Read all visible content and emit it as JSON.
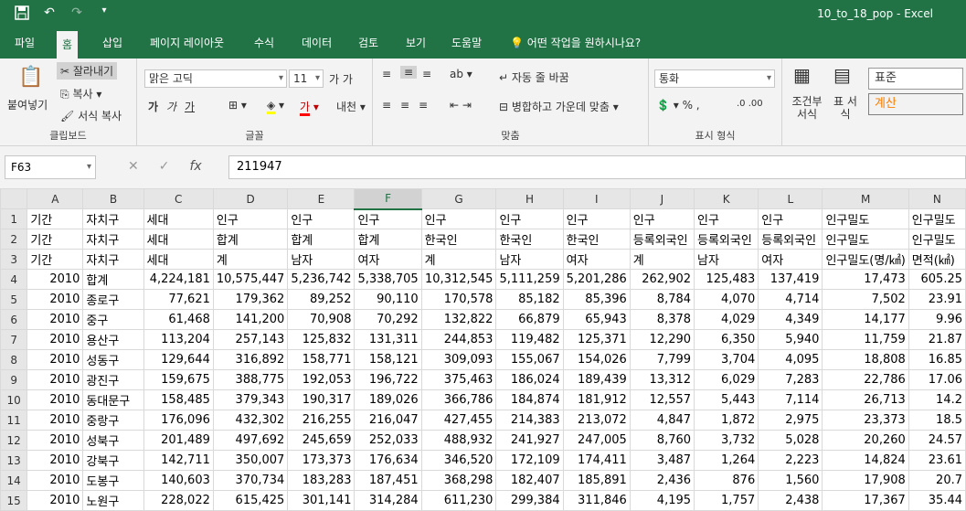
{
  "title_bar": {
    "window_title": "10_to_18_pop  -  Excel",
    "qat": {
      "save_icon": "save-icon",
      "undo_icon": "undo-icon",
      "redo_icon": "redo-icon",
      "customize_icon": "chevron-down-icon"
    }
  },
  "menu": {
    "tabs": [
      "파일",
      "홈",
      "삽입",
      "페이지 레이아웃",
      "수식",
      "데이터",
      "검토",
      "보기",
      "도움말"
    ],
    "active_tab": "홈",
    "tell_me": "어떤 작업을 원하시나요?"
  },
  "ribbon": {
    "clipboard": {
      "paste": "붙여넣기",
      "cut": "잘라내기",
      "copy": "복사",
      "format_painter": "서식 복사",
      "label": "클립보드"
    },
    "font": {
      "font_name": "맑은 고딕",
      "font_size": "11",
      "bold": "가",
      "italic": "가",
      "underline": "가",
      "label": "글꼴"
    },
    "alignment": {
      "wrap_text": "자동 줄 바꿈",
      "merge_center": "병합하고 가운데 맞춤",
      "label": "맞춤"
    },
    "number": {
      "format": "통화",
      "label": "표시 형식"
    },
    "styles": {
      "conditional": "조건부 서식",
      "table": "표 서식",
      "normal": "표준",
      "calculation": "계산"
    }
  },
  "formula_bar": {
    "name_box": "F63",
    "value": "211947"
  },
  "accent_color": "#217346",
  "grid": {
    "columns": [
      "A",
      "B",
      "C",
      "D",
      "E",
      "F",
      "G",
      "H",
      "I",
      "J",
      "K",
      "L",
      "M",
      "N"
    ],
    "selected_column": "F",
    "rows": [
      {
        "n": "1",
        "cells": [
          "기간",
          "자치구",
          "세대",
          "인구",
          "인구",
          "인구",
          "인구",
          "인구",
          "인구",
          "인구",
          "인구",
          "인구",
          "인구밀도",
          "인구밀도"
        ]
      },
      {
        "n": "2",
        "cells": [
          "기간",
          "자치구",
          "세대",
          "합계",
          "합계",
          "합계",
          "한국인",
          "한국인",
          "한국인",
          "등록외국인",
          "등록외국인",
          "등록외국인",
          "인구밀도",
          "인구밀도"
        ]
      },
      {
        "n": "3",
        "cells": [
          "기간",
          "자치구",
          "세대",
          "계",
          "남자",
          "여자",
          "계",
          "남자",
          "여자",
          "계",
          "남자",
          "여자",
          "인구밀도(명/㎢)",
          "면적(㎢)"
        ]
      },
      {
        "n": "4",
        "cells": [
          "2010",
          "합계",
          "4,224,181",
          "10,575,447",
          "5,236,742",
          "5,338,705",
          "10,312,545",
          "5,111,259",
          "5,201,286",
          "262,902",
          "125,483",
          "137,419",
          "17,473",
          "605.25"
        ]
      },
      {
        "n": "5",
        "cells": [
          "2010",
          "종로구",
          "77,621",
          "179,362",
          "89,252",
          "90,110",
          "170,578",
          "85,182",
          "85,396",
          "8,784",
          "4,070",
          "4,714",
          "7,502",
          "23.91"
        ]
      },
      {
        "n": "6",
        "cells": [
          "2010",
          "중구",
          "61,468",
          "141,200",
          "70,908",
          "70,292",
          "132,822",
          "66,879",
          "65,943",
          "8,378",
          "4,029",
          "4,349",
          "14,177",
          "9.96"
        ]
      },
      {
        "n": "7",
        "cells": [
          "2010",
          "용산구",
          "113,204",
          "257,143",
          "125,832",
          "131,311",
          "244,853",
          "119,482",
          "125,371",
          "12,290",
          "6,350",
          "5,940",
          "11,759",
          "21.87"
        ]
      },
      {
        "n": "8",
        "cells": [
          "2010",
          "성동구",
          "129,644",
          "316,892",
          "158,771",
          "158,121",
          "309,093",
          "155,067",
          "154,026",
          "7,799",
          "3,704",
          "4,095",
          "18,808",
          "16.85"
        ]
      },
      {
        "n": "9",
        "cells": [
          "2010",
          "광진구",
          "159,675",
          "388,775",
          "192,053",
          "196,722",
          "375,463",
          "186,024",
          "189,439",
          "13,312",
          "6,029",
          "7,283",
          "22,786",
          "17.06"
        ]
      },
      {
        "n": "10",
        "cells": [
          "2010",
          "동대문구",
          "158,485",
          "379,343",
          "190,317",
          "189,026",
          "366,786",
          "184,874",
          "181,912",
          "12,557",
          "5,443",
          "7,114",
          "26,713",
          "14.2"
        ]
      },
      {
        "n": "11",
        "cells": [
          "2010",
          "중랑구",
          "176,096",
          "432,302",
          "216,255",
          "216,047",
          "427,455",
          "214,383",
          "213,072",
          "4,847",
          "1,872",
          "2,975",
          "23,373",
          "18.5"
        ]
      },
      {
        "n": "12",
        "cells": [
          "2010",
          "성북구",
          "201,489",
          "497,692",
          "245,659",
          "252,033",
          "488,932",
          "241,927",
          "247,005",
          "8,760",
          "3,732",
          "5,028",
          "20,260",
          "24.57"
        ]
      },
      {
        "n": "13",
        "cells": [
          "2010",
          "강북구",
          "142,711",
          "350,007",
          "173,373",
          "176,634",
          "346,520",
          "172,109",
          "174,411",
          "3,487",
          "1,264",
          "2,223",
          "14,824",
          "23.61"
        ]
      },
      {
        "n": "14",
        "cells": [
          "2010",
          "도봉구",
          "140,603",
          "370,734",
          "183,283",
          "187,451",
          "368,298",
          "182,407",
          "185,891",
          "2,436",
          "876",
          "1,560",
          "17,908",
          "20.7"
        ]
      },
      {
        "n": "15",
        "cells": [
          "2010",
          "노원구",
          "228,022",
          "615,425",
          "301,141",
          "314,284",
          "611,230",
          "299,384",
          "311,846",
          "4,195",
          "1,757",
          "2,438",
          "17,367",
          "35.44"
        ]
      }
    ]
  }
}
